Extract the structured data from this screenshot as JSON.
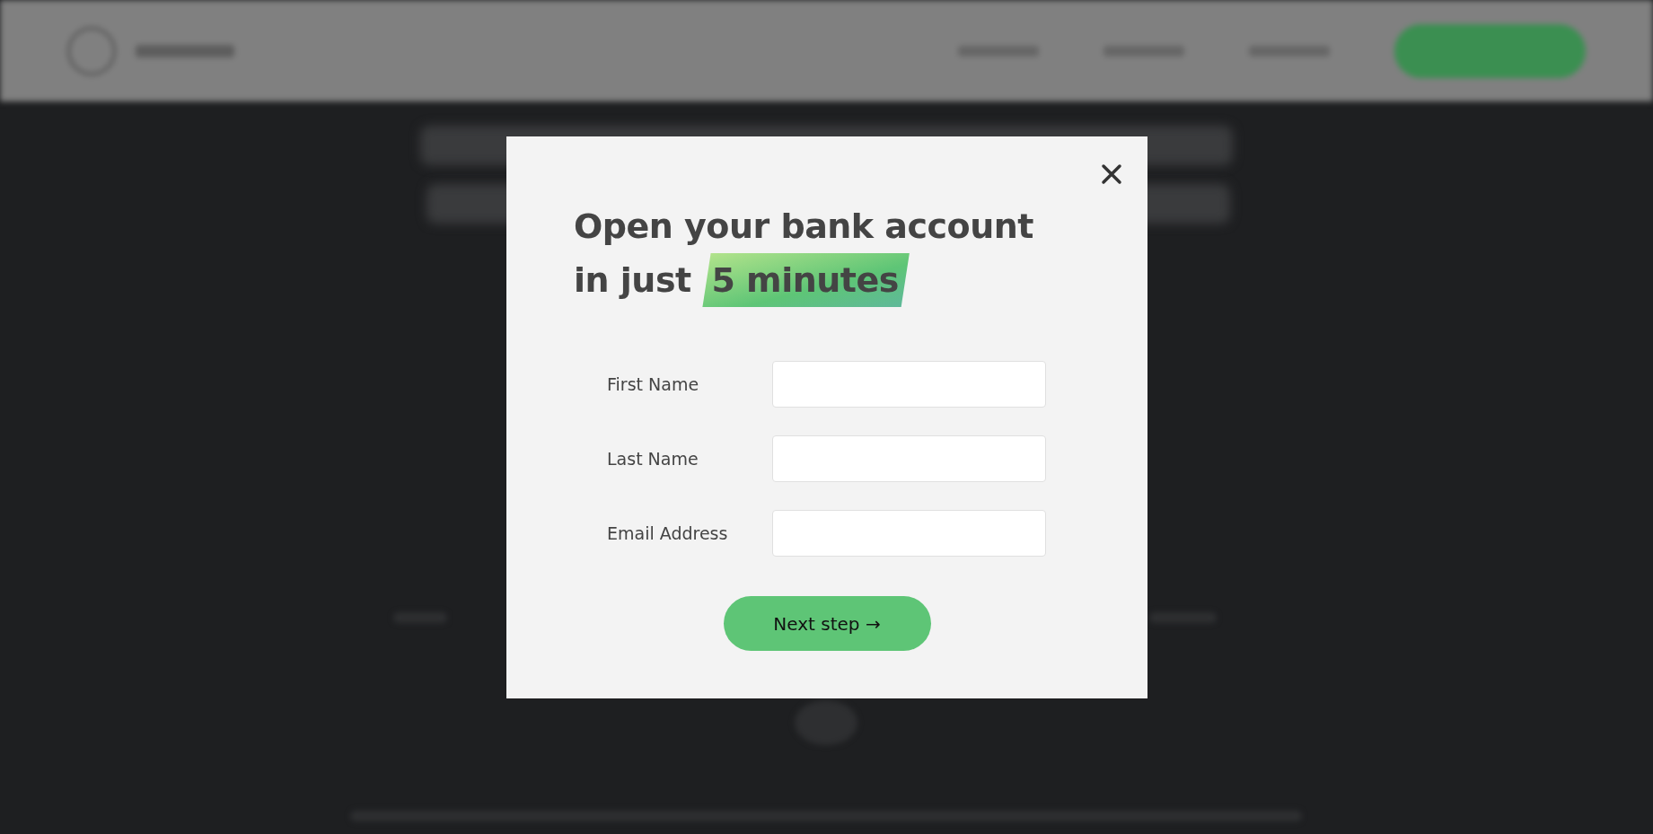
{
  "modal": {
    "title": "Open your bank account in just",
    "title_highlight": "5 minutes",
    "fields": [
      {
        "label": "First Name"
      },
      {
        "label": "Last Name"
      },
      {
        "label": "Email Address"
      }
    ],
    "submit": "Next step →"
  }
}
